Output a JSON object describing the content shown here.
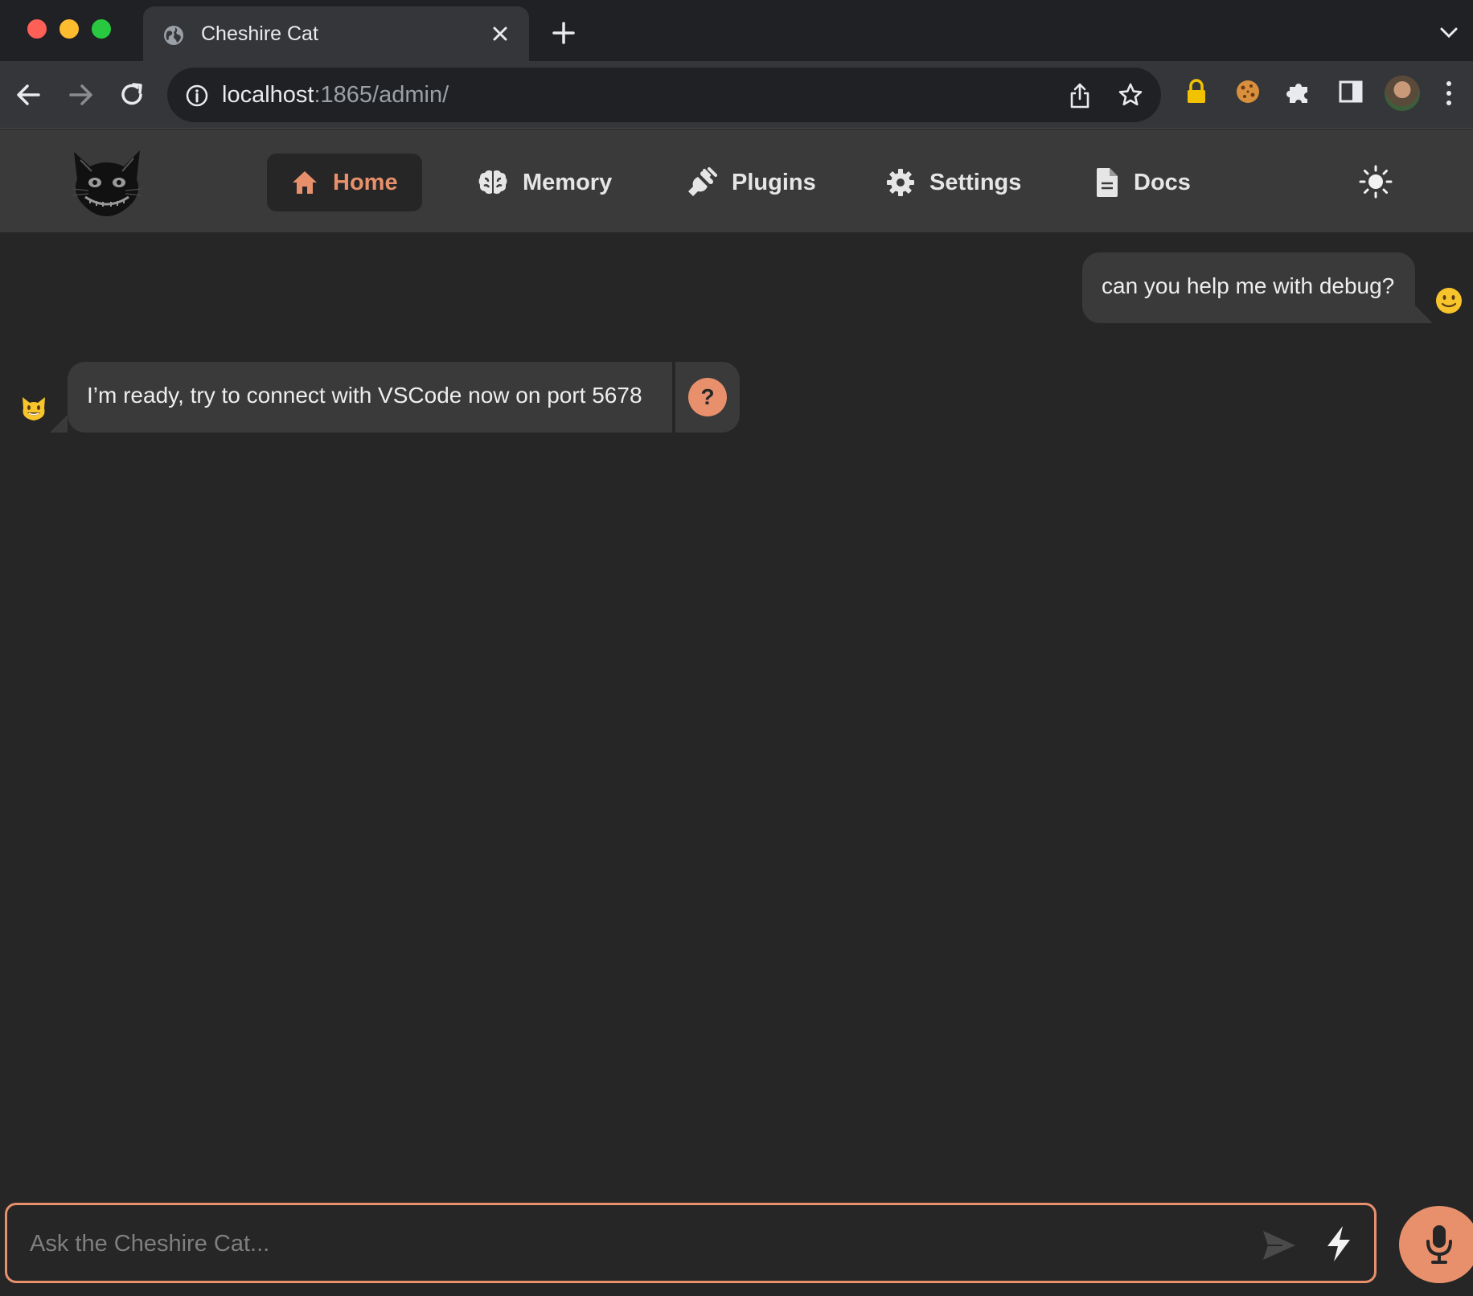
{
  "browser": {
    "tab_title": "Cheshire Cat",
    "url_host": "localhost",
    "url_rest": ":1865/admin/"
  },
  "app": {
    "nav": [
      {
        "label": "Home",
        "icon": "home-icon",
        "active": true
      },
      {
        "label": "Memory",
        "icon": "brain-icon",
        "active": false
      },
      {
        "label": "Plugins",
        "icon": "plug-icon",
        "active": false
      },
      {
        "label": "Settings",
        "icon": "gear-icon",
        "active": false
      },
      {
        "label": "Docs",
        "icon": "document-icon",
        "active": false
      }
    ],
    "accent_color": "#e8906c",
    "background_color": "#262626"
  },
  "chat": {
    "messages": [
      {
        "sender": "user",
        "text": "can you help me with debug?",
        "avatar": "slightly-smiling-face-emoji"
      },
      {
        "sender": "cat",
        "text": "I’m ready, try to connect with VSCode now on port 5678",
        "avatar": "grinning-cat-emoji",
        "why_label": "?"
      }
    ]
  },
  "input": {
    "placeholder": "Ask the Cheshire Cat...",
    "value": ""
  }
}
